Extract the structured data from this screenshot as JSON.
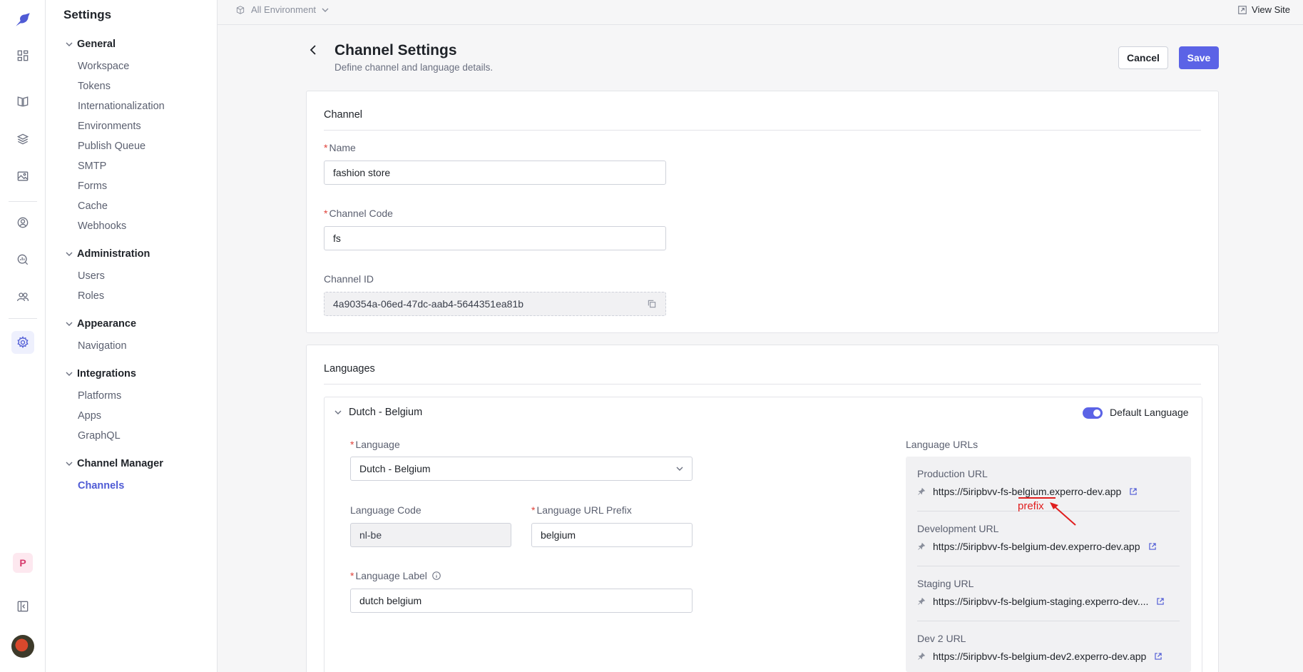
{
  "topbar": {
    "environment": "All Environment",
    "view_site": "View Site"
  },
  "settings_nav": {
    "title": "Settings",
    "groups": [
      {
        "label": "General",
        "items": [
          "Workspace",
          "Tokens",
          "Internationalization",
          "Environments",
          "Publish Queue",
          "SMTP",
          "Forms",
          "Cache",
          "Webhooks"
        ]
      },
      {
        "label": "Administration",
        "items": [
          "Users",
          "Roles"
        ]
      },
      {
        "label": "Appearance",
        "items": [
          "Navigation"
        ]
      },
      {
        "label": "Integrations",
        "items": [
          "Platforms",
          "Apps",
          "GraphQL"
        ]
      },
      {
        "label": "Channel Manager",
        "items": [
          "Channels"
        ]
      }
    ],
    "selected": "Channels"
  },
  "rail": {
    "workspace_badge": "P"
  },
  "header": {
    "title": "Channel Settings",
    "subtitle": "Define channel and language details.",
    "cancel_label": "Cancel",
    "save_label": "Save"
  },
  "channel": {
    "section_title": "Channel",
    "name_label": "Name",
    "name_value": "fashion store",
    "code_label": "Channel Code",
    "code_value": "fs",
    "id_label": "Channel ID",
    "id_value": "4a90354a-06ed-47dc-aab4-5644351ea81b"
  },
  "languages": {
    "section_title": "Languages",
    "item_title": "Dutch - Belgium",
    "default_language_label": "Default Language",
    "default_language_on": true,
    "language_label": "Language",
    "language_value": "Dutch - Belgium",
    "code_label": "Language Code",
    "code_value": "nl-be",
    "prefix_label": "Language URL Prefix",
    "prefix_value": "belgium",
    "label_label": "Language Label",
    "label_value": "dutch belgium",
    "urls_title": "Language URLs",
    "urls": [
      {
        "label": "Production URL",
        "value": "https://5iripbvv-fs-belgium.experro-dev.app"
      },
      {
        "label": "Development URL",
        "value": "https://5iripbvv-fs-belgium-dev.experro-dev.app"
      },
      {
        "label": "Staging URL",
        "value": "https://5iripbvv-fs-belgium-staging.experro-dev...."
      },
      {
        "label": "Dev 2 URL",
        "value": "https://5iripbvv-fs-belgium-dev2.experro-dev.app"
      }
    ],
    "annotation": "prefix"
  },
  "colors": {
    "accent": "#5b63e6",
    "annotation": "#e01e1e",
    "required": "#e0423a"
  }
}
